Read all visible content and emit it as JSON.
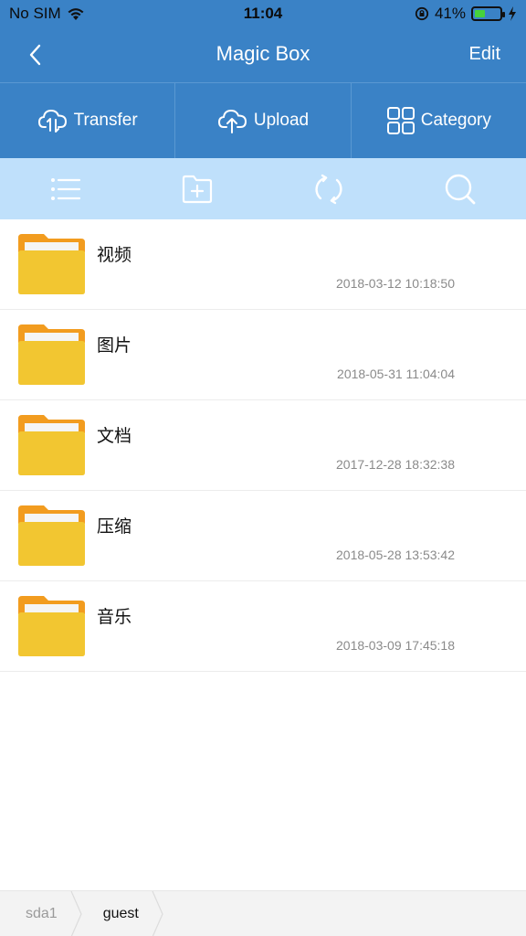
{
  "status_bar": {
    "carrier": "No SIM",
    "time": "11:04",
    "battery_percent": "41%",
    "battery_level": 0.41
  },
  "nav": {
    "title": "Magic Box",
    "edit_label": "Edit",
    "back_icon": "chevron-left-icon"
  },
  "actions": [
    {
      "label": "Transfer",
      "icon": "cloud-transfer-icon"
    },
    {
      "label": "Upload",
      "icon": "cloud-upload-icon"
    },
    {
      "label": "Category",
      "icon": "grid-icon"
    }
  ],
  "toolbar": {
    "icons": [
      "list-icon",
      "new-folder-icon",
      "refresh-icon",
      "search-icon"
    ]
  },
  "files": [
    {
      "name": "视频",
      "date": "2018-03-12 10:18:50"
    },
    {
      "name": "图片",
      "date": "2018-05-31 11:04:04"
    },
    {
      "name": "文档",
      "date": "2017-12-28 18:32:38"
    },
    {
      "name": "压缩",
      "date": "2018-05-28 13:53:42"
    },
    {
      "name": "音乐",
      "date": "2018-03-09 17:45:18"
    }
  ],
  "breadcrumb": {
    "items": [
      "sda1",
      "guest"
    ]
  },
  "colors": {
    "header": "#3a82c6",
    "toolbar": "#bfe0fb",
    "folder": "#f2c631",
    "folder_tab": "#f29c1f"
  }
}
